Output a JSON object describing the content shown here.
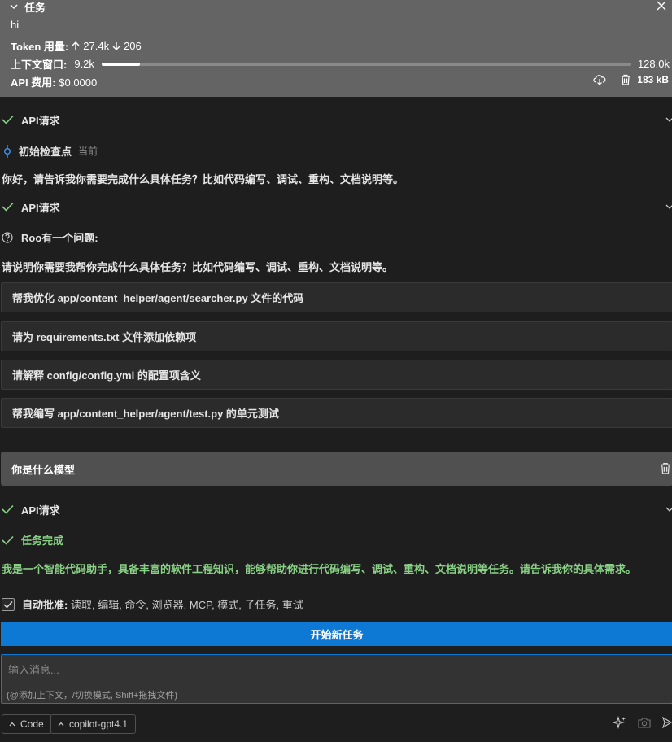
{
  "task": {
    "title": "任务",
    "text": "hi",
    "token_label": "Token 用量:",
    "tokens_up": "27.4k",
    "tokens_down": "206",
    "context_label": "上下文窗口:",
    "context_used": "9.2k",
    "context_max": "128.0k",
    "context_fraction": 0.072,
    "cost_label": "API 费用:",
    "cost_value": "$0.0000",
    "size": "183 kB"
  },
  "chat": {
    "api_request_1": "API请求",
    "checkpoint_label": "初始检查点",
    "checkpoint_meta": "当前",
    "assistant_msg_1": "你好，请告诉我你需要完成什么具体任务？比如代码编写、调试、重构、文档说明等。",
    "api_request_2": "API请求",
    "question_label": "Roo有一个问题:",
    "question_text": "请说明你需要我帮你完成什么具体任务？比如代码编写、调试、重构、文档说明等。",
    "suggestions": [
      "帮我优化 app/content_helper/agent/searcher.py 文件的代码",
      "请为 requirements.txt 文件添加依赖项",
      "请解释 config/config.yml 的配置项含义",
      "帮我编写 app/content_helper/agent/test.py 的单元测试"
    ],
    "user_msg": "你是什么模型",
    "api_request_3": "API请求",
    "task_complete": "任务完成",
    "completion_msg": "我是一个智能代码助手，具备丰富的软件工程知识，能够帮助你进行代码编写、调试、重构、文档说明等任务。请告诉我你的具体需求。"
  },
  "auto_approve": {
    "label": "自动批准:",
    "items": "读取, 编辑, 命令, 浏览器, MCP, 模式, 子任务, 重试"
  },
  "new_task_button": "开始新任务",
  "input": {
    "placeholder": "输入消息...",
    "hint": "(@添加上下文，/切换模式, Shift+拖拽文件)"
  },
  "footer": {
    "mode": "Code",
    "model": "copilot-gpt4.1"
  },
  "colors": {
    "accent": "#0e78d5",
    "success": "#89d185",
    "header_bg": "#646464"
  }
}
